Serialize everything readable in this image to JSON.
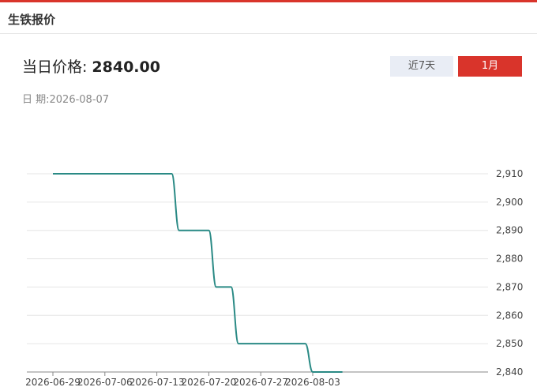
{
  "header": {
    "title": "生铁报价"
  },
  "price": {
    "label": "当日价格:",
    "value": "2840.00"
  },
  "date": {
    "label": "日 期:",
    "value": "2026-08-07"
  },
  "tabs": {
    "week_label": "近7天",
    "month_label": "1月"
  },
  "colors": {
    "accent": "#d9342b",
    "line": "#2a8a85",
    "tab_inactive_bg": "#e9edf5"
  },
  "chart_data": {
    "type": "line",
    "x_tick_labels": [
      "2026-06-29",
      "2026-07-06",
      "2026-07-13",
      "2026-07-20",
      "2026-07-27",
      "2026-08-03"
    ],
    "y_tick_labels": [
      "2,910",
      "2,900",
      "2,890",
      "2,880",
      "2,870",
      "2,860",
      "2,850",
      "2,840"
    ],
    "ylim": [
      2840,
      2910
    ],
    "grid": true,
    "series": [
      {
        "x": [
          "2026-06-29",
          "2026-06-30",
          "2026-07-01",
          "2026-07-02",
          "2026-07-03",
          "2026-07-04",
          "2026-07-05",
          "2026-07-06",
          "2026-07-07",
          "2026-07-08",
          "2026-07-09",
          "2026-07-10",
          "2026-07-11",
          "2026-07-12",
          "2026-07-13",
          "2026-07-14",
          "2026-07-15",
          "2026-07-16",
          "2026-07-17",
          "2026-07-18",
          "2026-07-19",
          "2026-07-20",
          "2026-07-21",
          "2026-07-22",
          "2026-07-23",
          "2026-07-24",
          "2026-07-25",
          "2026-07-26",
          "2026-07-27",
          "2026-07-28",
          "2026-07-29",
          "2026-07-30",
          "2026-07-31",
          "2026-08-01",
          "2026-08-02",
          "2026-08-03",
          "2026-08-04",
          "2026-08-05",
          "2026-08-06",
          "2026-08-07"
        ],
        "values": [
          2910,
          2910,
          2910,
          2910,
          2910,
          2910,
          2910,
          2910,
          2910,
          2910,
          2910,
          2910,
          2910,
          2910,
          2910,
          2910,
          2910,
          2890,
          2890,
          2890,
          2890,
          2890,
          2870,
          2870,
          2870,
          2850,
          2850,
          2850,
          2850,
          2850,
          2850,
          2850,
          2850,
          2850,
          2850,
          2840,
          2840,
          2840,
          2840,
          2840
        ]
      }
    ]
  }
}
